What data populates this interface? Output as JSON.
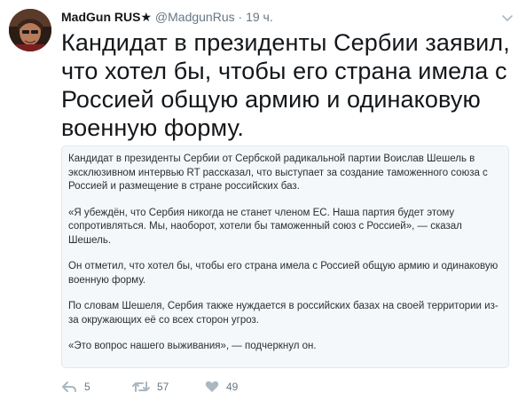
{
  "tweet": {
    "author_name": "MadGun RUS",
    "author_star": "★",
    "handle": "@MadgunRus",
    "separator": "·",
    "time": "19 ч.",
    "text": "Кандидат в президенты Сербии заявил, что хотел бы, чтобы его страна имела с Россией общую армию и одинаковую военную форму."
  },
  "quote": {
    "paragraphs": [
      "Кандидат в президенты Сербии от Сербской радикальной партии Воислав Шешель в эксклюзивном интервью RT рассказал, что выступает за создание таможенного союза с Россией и размещение в стране российских баз.",
      "«Я убеждён, что Сербия никогда не станет членом ЕС. Наша партия будет этому сопротивляться. Мы, наоборот, хотели бы таможенный союз с Россией», — сказал Шешель.",
      "Он отметил, что хотел бы, чтобы его страна имела с Россией общую армию и одинаковую военную форму.",
      "По словам Шешеля, Сербия также нуждается в российских базах на своей территории из-за окружающих её со всех сторон угроз.",
      "«Это вопрос нашего выживания», — подчеркнул он."
    ]
  },
  "actions": {
    "reply_count": "5",
    "retweet_count": "57",
    "like_count": "49"
  },
  "icons": {
    "reply": "reply-icon",
    "retweet": "retweet-icon",
    "like": "heart-icon",
    "caret": "chevron-down-icon"
  },
  "colors": {
    "text": "#14171a",
    "secondary": "#657786",
    "quote_bg": "#f5f8fa",
    "quote_border": "#e1e8ed",
    "icon": "#aab8c2"
  }
}
